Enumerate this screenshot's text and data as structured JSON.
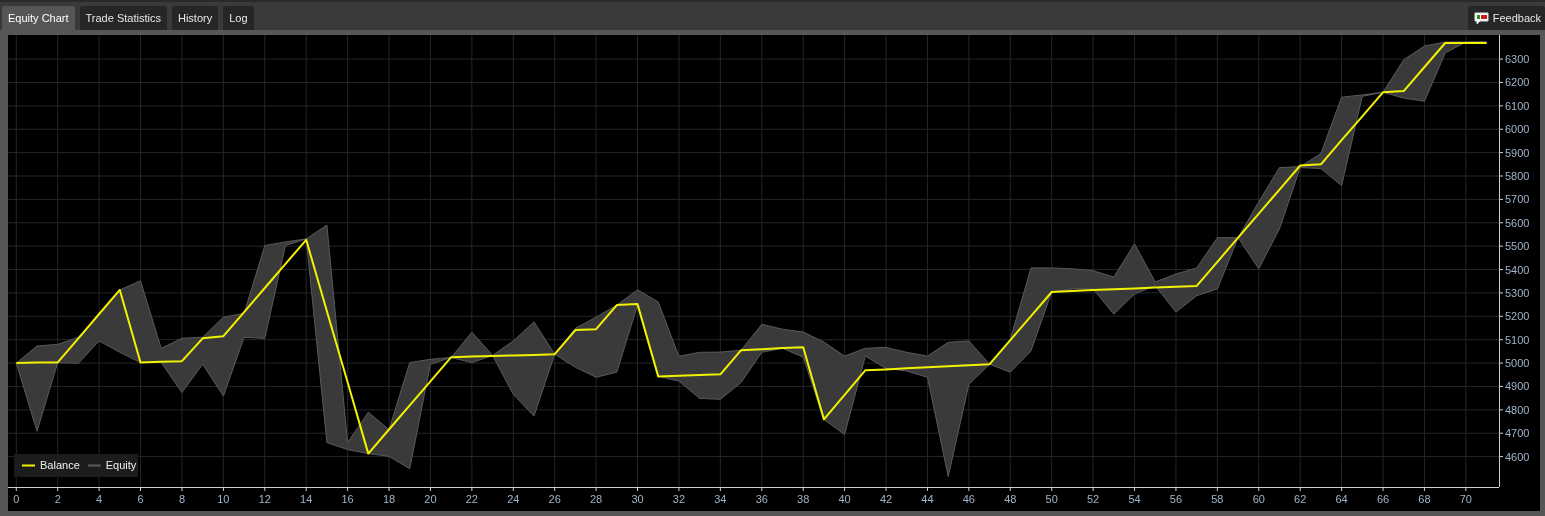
{
  "tabs": [
    {
      "label": "Equity Chart",
      "selected": true
    },
    {
      "label": "Trade Statistics",
      "selected": false
    },
    {
      "label": "History",
      "selected": false
    },
    {
      "label": "Log",
      "selected": false
    }
  ],
  "feedback_button": {
    "label": "Feedback"
  },
  "chart": {
    "chart_data": {
      "type": "line",
      "grid": true,
      "legend": "lower left",
      "x": [
        0,
        1,
        2,
        3,
        4,
        5,
        6,
        7,
        8,
        9,
        10,
        11,
        12,
        13,
        14,
        15,
        16,
        17,
        18,
        19,
        20,
        21,
        22,
        23,
        24,
        25,
        26,
        27,
        28,
        29,
        30,
        31,
        32,
        33,
        34,
        35,
        36,
        37,
        38,
        39,
        40,
        41,
        42,
        43,
        44,
        45,
        46,
        47,
        48,
        49,
        50,
        51,
        52,
        53,
        54,
        55,
        56,
        57,
        58,
        59,
        60,
        61,
        62,
        63,
        64,
        65,
        66,
        67,
        68,
        69,
        70,
        71
      ],
      "xlim": [
        -0.4,
        71.6
      ],
      "ylim": [
        4470,
        6403
      ],
      "xticks": [
        0,
        2,
        4,
        6,
        8,
        10,
        12,
        14,
        16,
        18,
        20,
        22,
        24,
        26,
        28,
        30,
        32,
        34,
        36,
        38,
        40,
        42,
        44,
        46,
        48,
        50,
        52,
        54,
        56,
        58,
        60,
        62,
        64,
        66,
        68,
        70
      ],
      "yticks": [
        4600,
        4700,
        4800,
        4900,
        5000,
        5100,
        5200,
        5300,
        5400,
        5500,
        5600,
        5700,
        5800,
        5900,
        6000,
        6100,
        6200,
        6300
      ],
      "series": [
        {
          "name": "Equity",
          "color": "#5a5a5a",
          "values": [
            5000,
            5073,
            5080,
            5110,
            5210,
            5313,
            5352,
            5063,
            5106,
            5110,
            5196,
            5213,
            5503,
            5518,
            5531,
            5590,
            4660,
            4790,
            4715,
            5002,
            5016,
            5024,
            5132,
            5033,
            5095,
            5176,
            5038,
            5149,
            5196,
            5248,
            5313,
            5262,
            5029,
            5046,
            5047,
            5055,
            5166,
            5145,
            5133,
            5090,
            5030,
            5063,
            5067,
            5046,
            5030,
            5089,
            5095,
            4995,
            5102,
            5407,
            5407,
            5403,
            5395,
            5368,
            5510,
            5347,
            5381,
            5407,
            5536,
            5536,
            5690,
            5836,
            5840,
            5896,
            6137,
            6147,
            6158,
            6297,
            6356,
            6373,
            6373,
            6373
          ]
        },
        {
          "color": "#5a5a5a",
          "values": [
            5000,
            4708,
            5002,
            4999,
            5095,
            5046,
            5002,
            5003,
            4874,
            4995,
            4859,
            5110,
            5106,
            5503,
            5531,
            4660,
            4630,
            4613,
            4601,
            4548,
            4995,
            5024,
            5002,
            5033,
            4866,
            4773,
            5038,
            4982,
            4939,
            4961,
            5248,
            4944,
            4923,
            4849,
            4845,
            4917,
            5046,
            5063,
            5025,
            4759,
            4694,
            5030,
            4977,
            4966,
            4939,
            4515,
            4909,
            4995,
            4961,
            5052,
            5304,
            5317,
            5317,
            5209,
            5295,
            5331,
            5218,
            5288,
            5317,
            5536,
            5403,
            5574,
            5836,
            5832,
            5759,
            6141,
            6158,
            6133,
            6120,
            6326,
            6373,
            6373
          ]
        },
        {
          "name": "Balance",
          "color": "#f2f200",
          "values": [
            5000,
            5002,
            5003,
            5106,
            5210,
            5313,
            5003,
            5006,
            5008,
            5106,
            5115,
            5218,
            5321,
            5424,
            5527,
            5222,
            4918,
            4613,
            4716,
            4819,
            4922,
            5025,
            5028,
            5030,
            5033,
            5035,
            5038,
            5141,
            5145,
            5248,
            5252,
            4943,
            4946,
            4949,
            4952,
            5055,
            5059,
            5064,
            5068,
            4759,
            4864,
            4969,
            4973,
            4978,
            4982,
            4986,
            4991,
            4995,
            5098,
            5201,
            5304,
            5308,
            5312,
            5316,
            5319,
            5323,
            5326,
            5330,
            5433,
            5536,
            5639,
            5742,
            5845,
            5850,
            5953,
            6055,
            6158,
            6163,
            6266,
            6369,
            6369,
            6369
          ]
        }
      ]
    }
  }
}
